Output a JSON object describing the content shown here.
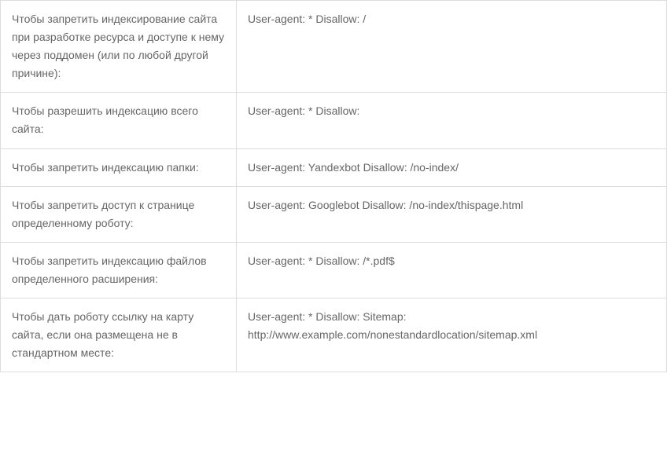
{
  "table": {
    "rows": [
      {
        "description": "Чтобы запретить индексирование сайта при разработке ресурса и доступе к нему через поддомен (или по любой другой причине):",
        "rule": "User-agent: * Disallow: /"
      },
      {
        "description": "Чтобы разрешить индексацию всего сайта:",
        "rule": "User-agent: * Disallow:"
      },
      {
        "description": "Чтобы запретить индексацию папки:",
        "rule": "User-agent: Yandexbot Disallow: /no-index/"
      },
      {
        "description": "Чтобы запретить доступ к странице определенному роботу:",
        "rule": "User-agent: Googlebot Disallow: /no-index/thispage.html"
      },
      {
        "description": "Чтобы запретить индексацию файлов определенного расширения:",
        "rule": "User-agent: * Disallow: /*.pdf$"
      },
      {
        "description": "Чтобы дать роботу ссылку на карту сайта, если она размещена не в стандартном месте:",
        "rule": "User-agent: * Disallow: Sitemap: http://www.example.com/nonestandardlocation/sitemap.xml"
      }
    ]
  }
}
